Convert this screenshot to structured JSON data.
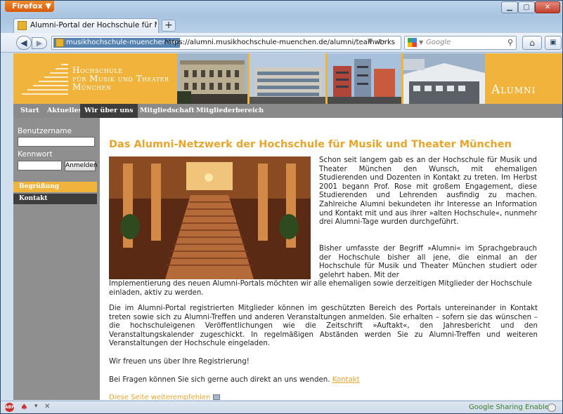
{
  "browser": {
    "menu_button": "Firefox ▼",
    "tab_title": "Alumni-Portal der Hochschule für Musik...",
    "new_tab": "+",
    "site_identity": "musikhochschule-muenchen.de",
    "url": "https://alumni.musikhochschule-muenchen.de/alumni/teamworks",
    "search_placeholder": "Google",
    "status_text": "Google Sharing Enabled",
    "abp": "ABP"
  },
  "site": {
    "logo_line1": "Hochschule",
    "logo_line2": "für Musik und Theater",
    "logo_line3": "München",
    "alumni_label": "Alumni",
    "nav": [
      "Start",
      "Aktuelles",
      "Wir über uns",
      "Mitgliedschaft",
      "Mitgliederbereich"
    ],
    "active_nav": "Wir über uns"
  },
  "login": {
    "username_label": "Benutzername",
    "password_label": "Kennwort",
    "submit": "Anmelden"
  },
  "sidenav": [
    "Begrüßung",
    "Kontakt"
  ],
  "content": {
    "heading": "Das Alumni-Netzwerk der Hochschule für Musik und Theater München",
    "p1": "Schon seit langem gab es an der Hochschule für Musik und Theater München den Wunsch, mit ehemaligen Studierenden und Dozenten in Kontakt zu treten. Im Herbst 2001 begann Prof. Rose mit großem Engagement, diese Studierenden und Lehrenden ausfindig zu machen. Zahlreiche Alumni bekundeten ihr Interesse an Information und Kontakt mit und aus ihrer »alten Hochschule«, nunmehr drei Alumni-Tage wurden durchgeführt.",
    "p2a": "Bisher umfasste der Begriff »Alumni« im Sprachgebrauch der Hochschule bisher all jene, die einmal an der Hochschule für Musik und Theater München studiert oder gelehrt haben. Mit der",
    "p2b": "Implementierung des neuen Alumni-Portals möchten wir alle ehemaligen sowie derzeitigen Mitglieder der Hochschule einladen, aktiv zu werden.",
    "p3": "Die im Alumni-Portal registrierten Mitglieder können im geschützten Bereich des Portals untereinander in Kontakt treten sowie sich zu Alumni-Treffen und anderen Veranstaltungen anmelden. Sie erhalten – sofern sie das wünschen – die hochschuleigenen Veröffentlichungen wie die Zeitschrift »Auftakt«, den Jahresbericht und den Veranstaltungskalender zugeschickt. In regelmäßigen Abständen werden Sie zu Alumni-Treffen und weiteren Veranstaltungen der Hochschule eingeladen.",
    "p4": "Wir freuen uns über Ihre Registrierung!",
    "p5": "Bei Fragen können Sie sich gerne auch direkt an uns wenden.",
    "contact_link": "Kontakt",
    "recommend_link": "Diese Seite weiterempfehlen"
  },
  "colors": {
    "brand_yellow": "#f0b43c",
    "heading": "#e8a52b",
    "nav_gray": "#8a8a8a",
    "nav_active": "#3d3d3d"
  }
}
